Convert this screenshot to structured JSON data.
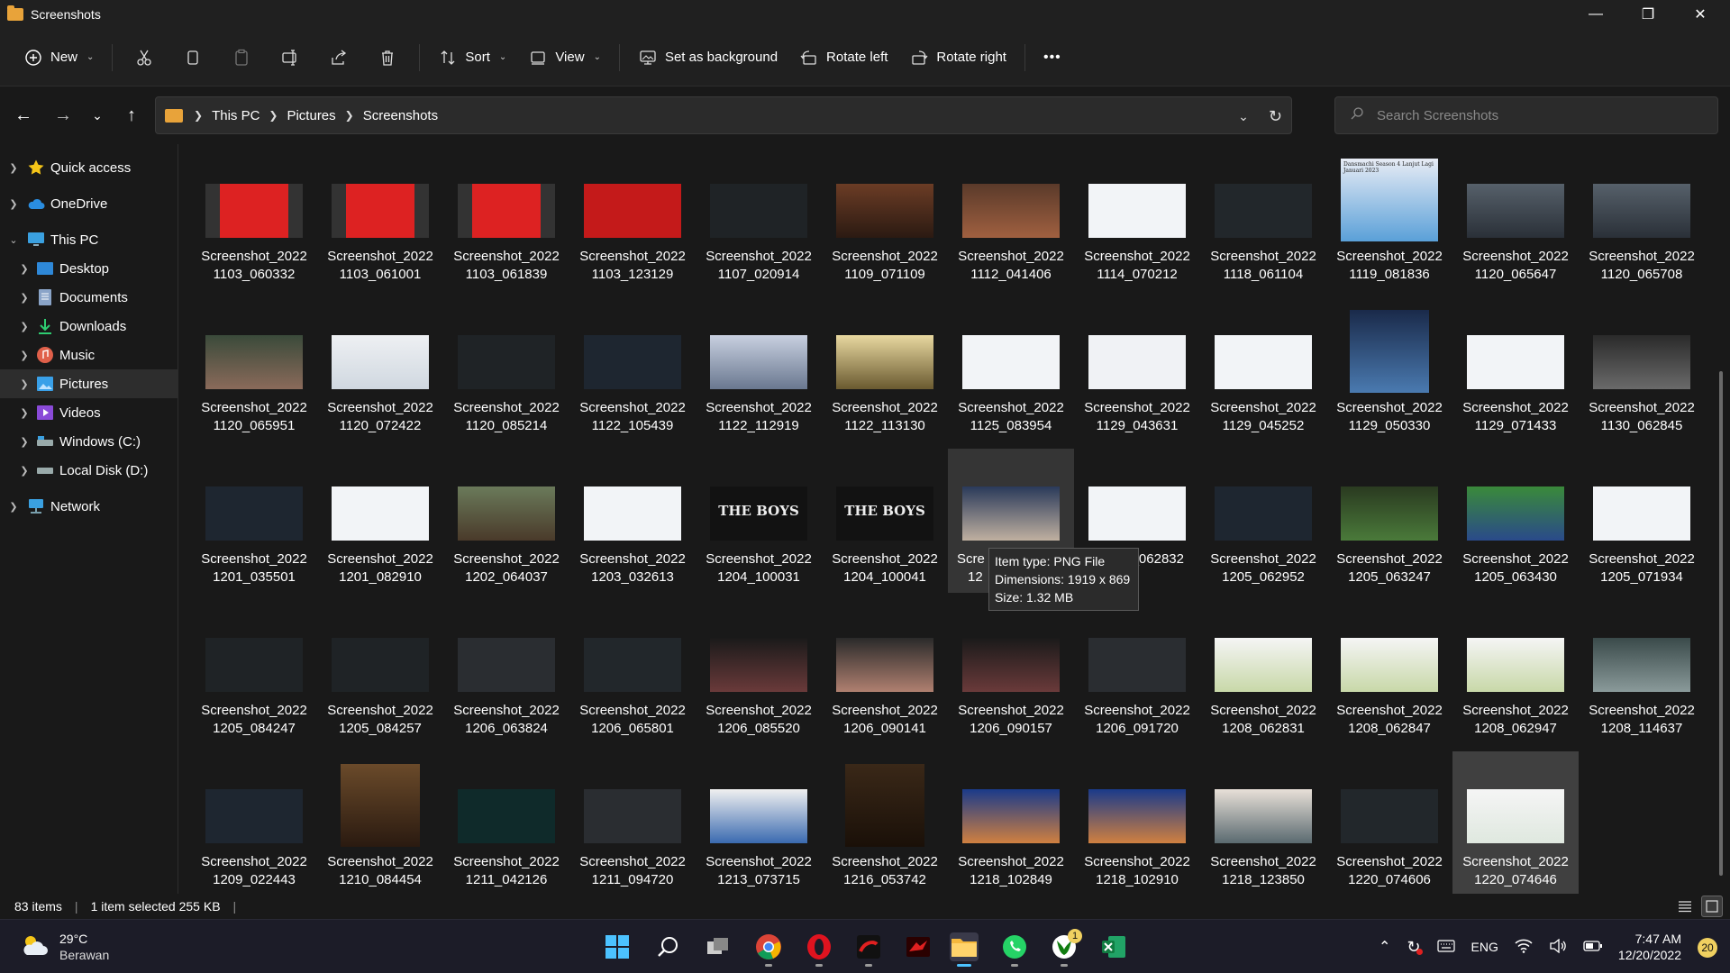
{
  "window": {
    "title": "Screenshots"
  },
  "toolbar": {
    "new_label": "New",
    "sort_label": "Sort",
    "view_label": "View",
    "set_background_label": "Set as background",
    "rotate_left_label": "Rotate left",
    "rotate_right_label": "Rotate right",
    "more_label": "•••"
  },
  "address": {
    "crumbs": [
      "This PC",
      "Pictures",
      "Screenshots"
    ],
    "search_placeholder": "Search Screenshots"
  },
  "nav": {
    "items": [
      {
        "label": "Quick access",
        "icon": "star-icon"
      },
      {
        "label": "OneDrive",
        "icon": "cloud-icon"
      },
      {
        "label": "This PC",
        "icon": "computer-icon"
      },
      {
        "label": "Desktop",
        "icon": "desktop-folder-icon"
      },
      {
        "label": "Documents",
        "icon": "documents-folder-icon"
      },
      {
        "label": "Downloads",
        "icon": "downloads-folder-icon"
      },
      {
        "label": "Music",
        "icon": "music-folder-icon"
      },
      {
        "label": "Pictures",
        "icon": "pictures-folder-icon"
      },
      {
        "label": "Videos",
        "icon": "videos-folder-icon"
      },
      {
        "label": "Windows (C:)",
        "icon": "drive-icon"
      },
      {
        "label": "Local Disk (D:)",
        "icon": "drive-icon"
      },
      {
        "label": "Network",
        "icon": "network-icon"
      }
    ]
  },
  "files": [
    [
      "Screenshot_2022",
      "1103_060332"
    ],
    [
      "Screenshot_2022",
      "1103_061001"
    ],
    [
      "Screenshot_2022",
      "1103_061839"
    ],
    [
      "Screenshot_2022",
      "1103_123129"
    ],
    [
      "Screenshot_2022",
      "1107_020914"
    ],
    [
      "Screenshot_2022",
      "1109_071109"
    ],
    [
      "Screenshot_2022",
      "1112_041406"
    ],
    [
      "Screenshot_2022",
      "1114_070212"
    ],
    [
      "Screenshot_2022",
      "1118_061104"
    ],
    [
      "Screenshot_2022",
      "1119_081836"
    ],
    [
      "Screenshot_2022",
      "1120_065647"
    ],
    [
      "Screenshot_2022",
      "1120_065708"
    ],
    [
      "Screenshot_2022",
      "1120_065951"
    ],
    [
      "Screenshot_2022",
      "1120_072422"
    ],
    [
      "Screenshot_2022",
      "1120_085214"
    ],
    [
      "Screenshot_2022",
      "1122_105439"
    ],
    [
      "Screenshot_2022",
      "1122_112919"
    ],
    [
      "Screenshot_2022",
      "1122_113130"
    ],
    [
      "Screenshot_2022",
      "1125_083954"
    ],
    [
      "Screenshot_2022",
      "1129_043631"
    ],
    [
      "Screenshot_2022",
      "1129_045252"
    ],
    [
      "Screenshot_2022",
      "1129_050330"
    ],
    [
      "Screenshot_2022",
      "1129_071433"
    ],
    [
      "Screenshot_2022",
      "1130_062845"
    ],
    [
      "Screenshot_2022",
      "1201_035501"
    ],
    [
      "Screenshot_2022",
      "1201_082910"
    ],
    [
      "Screenshot_2022",
      "1202_064037"
    ],
    [
      "Screenshot_2022",
      "1203_032613"
    ],
    [
      "Screenshot_2022",
      "1204_100031"
    ],
    [
      "Screenshot_2022",
      "1204_100041"
    ],
    [
      "Scre",
      "12"
    ],
    [
      "",
      "_062832"
    ],
    [
      "Screenshot_2022",
      "1205_062952"
    ],
    [
      "Screenshot_2022",
      "1205_063247"
    ],
    [
      "Screenshot_2022",
      "1205_063430"
    ],
    [
      "Screenshot_2022",
      "1205_071934"
    ],
    [
      "Screenshot_2022",
      "1205_084247"
    ],
    [
      "Screenshot_2022",
      "1205_084257"
    ],
    [
      "Screenshot_2022",
      "1206_063824"
    ],
    [
      "Screenshot_2022",
      "1206_065801"
    ],
    [
      "Screenshot_2022",
      "1206_085520"
    ],
    [
      "Screenshot_2022",
      "1206_090141"
    ],
    [
      "Screenshot_2022",
      "1206_090157"
    ],
    [
      "Screenshot_2022",
      "1206_091720"
    ],
    [
      "Screenshot_2022",
      "1208_062831"
    ],
    [
      "Screenshot_2022",
      "1208_062847"
    ],
    [
      "Screenshot_2022",
      "1208_062947"
    ],
    [
      "Screenshot_2022",
      "1208_114637"
    ],
    [
      "Screenshot_2022",
      "1209_022443"
    ],
    [
      "Screenshot_2022",
      "1210_084454"
    ],
    [
      "Screenshot_2022",
      "1211_042126"
    ],
    [
      "Screenshot_2022",
      "1211_094720"
    ],
    [
      "Screenshot_2022",
      "1213_073715"
    ],
    [
      "Screenshot_2022",
      "1216_053742"
    ],
    [
      "Screenshot_2022",
      "1218_102849"
    ],
    [
      "Screenshot_2022",
      "1218_102910"
    ],
    [
      "Screenshot_2022",
      "1218_123850"
    ],
    [
      "Screenshot_2022",
      "1220_074606"
    ],
    [
      "Screenshot_2022",
      "1220_074646"
    ]
  ],
  "tooltip": {
    "type_line": "Item type: PNG File",
    "dim_line": "Dimensions: 1919 x 869",
    "size_line": "Size: 1.32 MB"
  },
  "thumb_text": {
    "boys": "THE BOYS",
    "article_title": "Dansmachi Season 4 Lanjut Lagi Januari 2023"
  },
  "status": {
    "count": "83 items",
    "selection": "1 item selected  255 KB"
  },
  "taskbar": {
    "temp": "29°C",
    "condition": "Berawan",
    "lang": "ENG",
    "time": "7:47 AM",
    "date": "12/20/2022",
    "notifications": "20",
    "xbox_badge": "1"
  },
  "colors": {
    "accent": "#4cc2ff",
    "folder": "#e8a33a",
    "background": "#191919"
  }
}
